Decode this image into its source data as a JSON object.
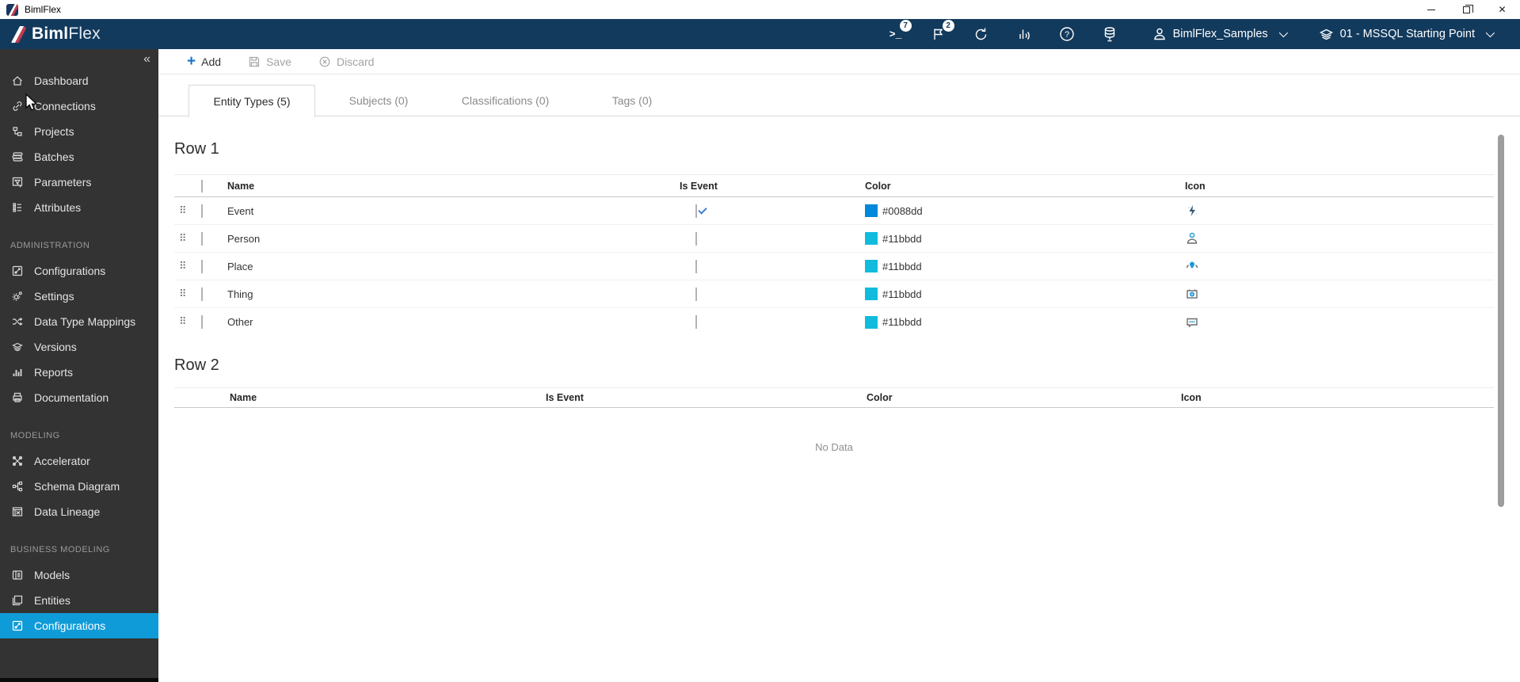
{
  "titlebar": {
    "title": "BimlFlex"
  },
  "header": {
    "logo": {
      "bold": "Biml",
      "light": "Flex"
    },
    "icons": [
      {
        "name": "terminal-icon",
        "badge": "7"
      },
      {
        "name": "flag-icon",
        "badge": "2"
      },
      {
        "name": "refresh-icon",
        "badge": ""
      },
      {
        "name": "insights-icon",
        "badge": ""
      },
      {
        "name": "help-icon",
        "badge": ""
      },
      {
        "name": "database-icon",
        "badge": ""
      }
    ],
    "account": {
      "label": "BimlFlex_Samples"
    },
    "environment": {
      "label": "01 - MSSQL Starting Point"
    }
  },
  "sidebar": {
    "collapse_glyph": "«",
    "sections": [
      {
        "label": "",
        "items": [
          {
            "label": "Dashboard"
          },
          {
            "label": "Connections"
          },
          {
            "label": "Projects"
          },
          {
            "label": "Batches"
          },
          {
            "label": "Parameters"
          },
          {
            "label": "Attributes"
          }
        ]
      },
      {
        "label": "ADMINISTRATION",
        "items": [
          {
            "label": "Configurations"
          },
          {
            "label": "Settings"
          },
          {
            "label": "Data Type Mappings"
          },
          {
            "label": "Versions"
          },
          {
            "label": "Reports"
          },
          {
            "label": "Documentation"
          }
        ]
      },
      {
        "label": "MODELING",
        "items": [
          {
            "label": "Accelerator"
          },
          {
            "label": "Schema Diagram"
          },
          {
            "label": "Data Lineage"
          }
        ]
      },
      {
        "label": "BUSINESS MODELING",
        "items": [
          {
            "label": "Models"
          },
          {
            "label": "Entities"
          },
          {
            "label": "Configurations",
            "selected": true
          }
        ]
      }
    ]
  },
  "toolbar": {
    "add": "Add",
    "save": "Save",
    "discard": "Discard"
  },
  "tabs": [
    {
      "label": "Entity Types (5)",
      "active": true
    },
    {
      "label": "Subjects (0)",
      "active": false
    },
    {
      "label": "Classifications (0)",
      "active": false
    },
    {
      "label": "Tags (0)",
      "active": false
    }
  ],
  "tables": [
    {
      "title": "Row 1",
      "columns": {
        "name": "Name",
        "is_event": "Is Event",
        "color": "Color",
        "icon": "Icon"
      },
      "rows": [
        {
          "name": "Event",
          "is_event": true,
          "color": "#0088dd",
          "icon": "bolt-icon"
        },
        {
          "name": "Person",
          "is_event": false,
          "color": "#11bbdd",
          "icon": "person-icon"
        },
        {
          "name": "Place",
          "is_event": false,
          "color": "#11bbdd",
          "icon": "location-icon"
        },
        {
          "name": "Thing",
          "is_event": false,
          "color": "#11bbdd",
          "icon": "camera-icon"
        },
        {
          "name": "Other",
          "is_event": false,
          "color": "#11bbdd",
          "icon": "chat-icon"
        }
      ]
    },
    {
      "title": "Row 2",
      "columns": {
        "name": "Name",
        "is_event": "Is Event",
        "color": "Color",
        "icon": "Icon"
      },
      "rows": [],
      "empty_text": "No Data"
    }
  ],
  "colors": {
    "header_navy": "#123a5d",
    "sidebar_bg": "#333333",
    "selected_blue": "#0f9bd8",
    "accent_blue": "#1673c6",
    "event_color": "#0088dd",
    "default_color": "#11bbdd"
  }
}
